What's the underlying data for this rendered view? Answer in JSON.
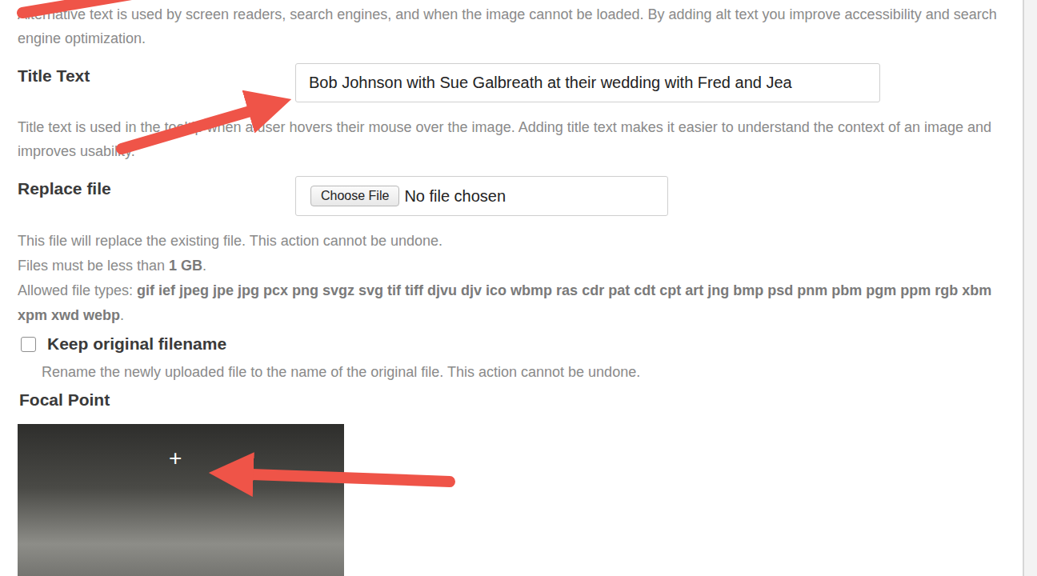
{
  "alt_text": {
    "description": "Alternative text is used by screen readers, search engines, and when the image cannot be loaded. By adding alt text you improve accessibility and search engine optimization."
  },
  "title_text": {
    "label": "Title Text",
    "value": "Bob Johnson with Sue Galbreath at their wedding with Fred and Jea",
    "description": "Title text is used in the tooltip when a user hovers their mouse over the image. Adding title text makes it easier to understand the context of an image and improves usability."
  },
  "replace_file": {
    "label": "Replace file",
    "button": "Choose File",
    "status": "No file chosen",
    "notes": [
      [
        {
          "text": "This file will replace the existing file. This action cannot be undone.",
          "bold": false
        }
      ],
      [
        {
          "text": "Files must be less than ",
          "bold": false
        },
        {
          "text": "1 GB",
          "bold": true
        },
        {
          "text": ".",
          "bold": false
        }
      ],
      [
        {
          "text": "Allowed file types: ",
          "bold": false
        },
        {
          "text": "gif ief jpeg jpe jpg pcx png svgz svg tif tiff djvu djv ico wbmp ras cdr pat cdt cpt art jng bmp psd pnm pbm pgm ppm rgb xbm xpm xwd webp",
          "bold": true
        },
        {
          "text": ".",
          "bold": false
        }
      ]
    ]
  },
  "keep_original": {
    "label": "Keep original filename",
    "checked": false,
    "description": "Rename the newly uploaded file to the name of the original file. This action cannot be undone."
  },
  "focal_point": {
    "label": "Focal Point",
    "marker": "+"
  }
}
